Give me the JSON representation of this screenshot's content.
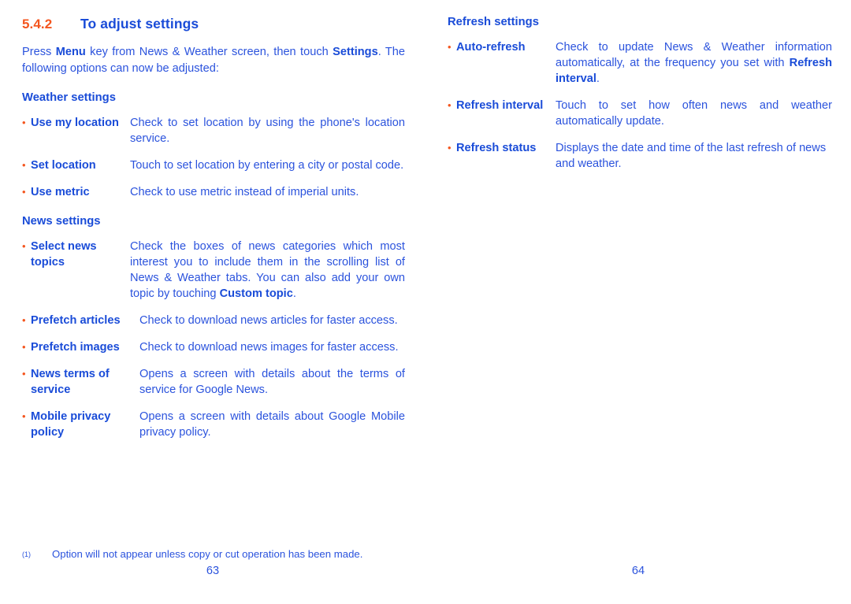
{
  "document": {
    "section_number": "5.4.2",
    "section_title": "To adjust settings",
    "intro": {
      "part1": "Press ",
      "bold1": "Menu",
      "part2": " key from News & Weather screen, then touch ",
      "bold2": "Settings",
      "part3": ". The following options can now be adjusted:"
    },
    "bullet_glyph": "•"
  },
  "left_column": {
    "weather_heading": "Weather settings",
    "weather_items": [
      {
        "term": "Use my location",
        "desc": "Check to set location by using the phone's location service."
      },
      {
        "term": "Set location",
        "desc": "Touch to set location by entering a city or postal code."
      },
      {
        "term": "Use metric",
        "desc": "Check to use metric instead of imperial units."
      }
    ],
    "news_heading": "News settings",
    "news_items": [
      {
        "term": "Select news topics",
        "desc_part1": "Check the boxes of news categories which most interest you to include them in the scrolling list of News & Weather tabs. You can also add your own topic by touching ",
        "desc_bold": "Custom topic",
        "desc_part2": "."
      },
      {
        "term": "Prefetch articles",
        "desc": "Check to download news articles for faster access."
      },
      {
        "term": "Prefetch images",
        "desc": "Check to download news images for faster access."
      },
      {
        "term": "News terms of service",
        "desc": "Opens a screen with details about the terms of service for Google News."
      },
      {
        "term": "Mobile privacy policy",
        "desc": "Opens a screen with details about Google Mobile privacy policy."
      }
    ]
  },
  "right_column": {
    "refresh_heading": "Refresh settings",
    "refresh_items": [
      {
        "term": "Auto-refresh",
        "desc_part1": "Check to update News & Weather information automatically, at the frequency you set with ",
        "desc_bold": "Refresh interval",
        "desc_part2": "."
      },
      {
        "term": "Refresh interval",
        "desc": "Touch to set how often news and weather automatically update."
      },
      {
        "term": "Refresh status",
        "desc": "Displays the date and time of the last refresh of news and weather."
      }
    ]
  },
  "footnote": {
    "marker": "(1)",
    "text": "Option will not appear unless copy or cut operation has been made."
  },
  "page_numbers": {
    "left": "63",
    "right": "64"
  },
  "colors": {
    "accent_orange": "#F4561F",
    "heading_blue": "#1A4CD8",
    "body_blue": "#2B53DD"
  }
}
